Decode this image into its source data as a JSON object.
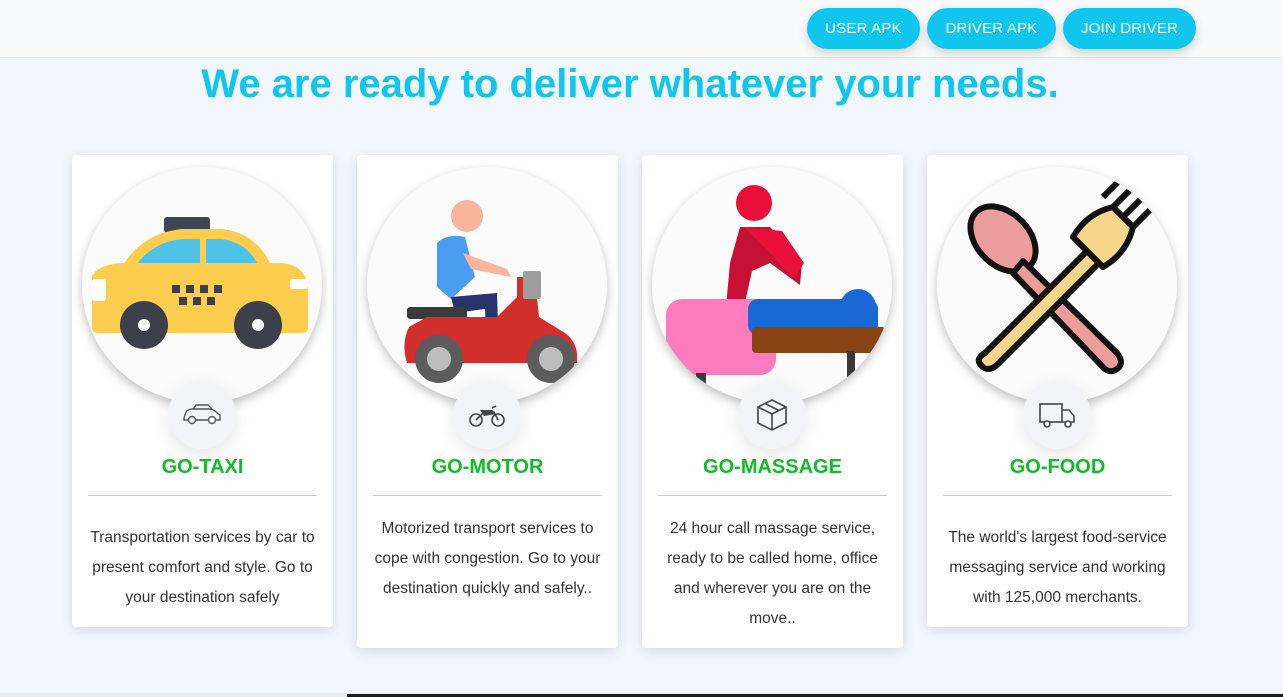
{
  "nav": {
    "user_apk": "USER APK",
    "driver_apk": "DRIVER APK",
    "join_driver": "JOIN DRIVER"
  },
  "headline": "We are ready to deliver whatever your needs.",
  "colors": {
    "accent": "#10c6ef",
    "title_green": "#0fbe27",
    "background": "#f2f6fd"
  },
  "services": [
    {
      "title": "GO-TAXI",
      "image": "taxi-illustration",
      "icon": "car-icon",
      "description": "Transportation services by car to present comfort and style. Go to your destination safely"
    },
    {
      "title": "GO-MOTOR",
      "image": "scooter-rider-illustration",
      "icon": "motorcycle-icon",
      "description": "Motorized transport services to cope with congestion. Go to your destination quickly and safely.."
    },
    {
      "title": "GO-MASSAGE",
      "image": "massage-illustration",
      "icon": "box-icon",
      "description": "24 hour call massage service, ready to be called home, office and wherever you are on the move.."
    },
    {
      "title": "GO-FOOD",
      "image": "spoon-fork-illustration",
      "icon": "truck-icon",
      "description": "The world's largest food-service messaging service and working with 125,000 merchants."
    }
  ]
}
